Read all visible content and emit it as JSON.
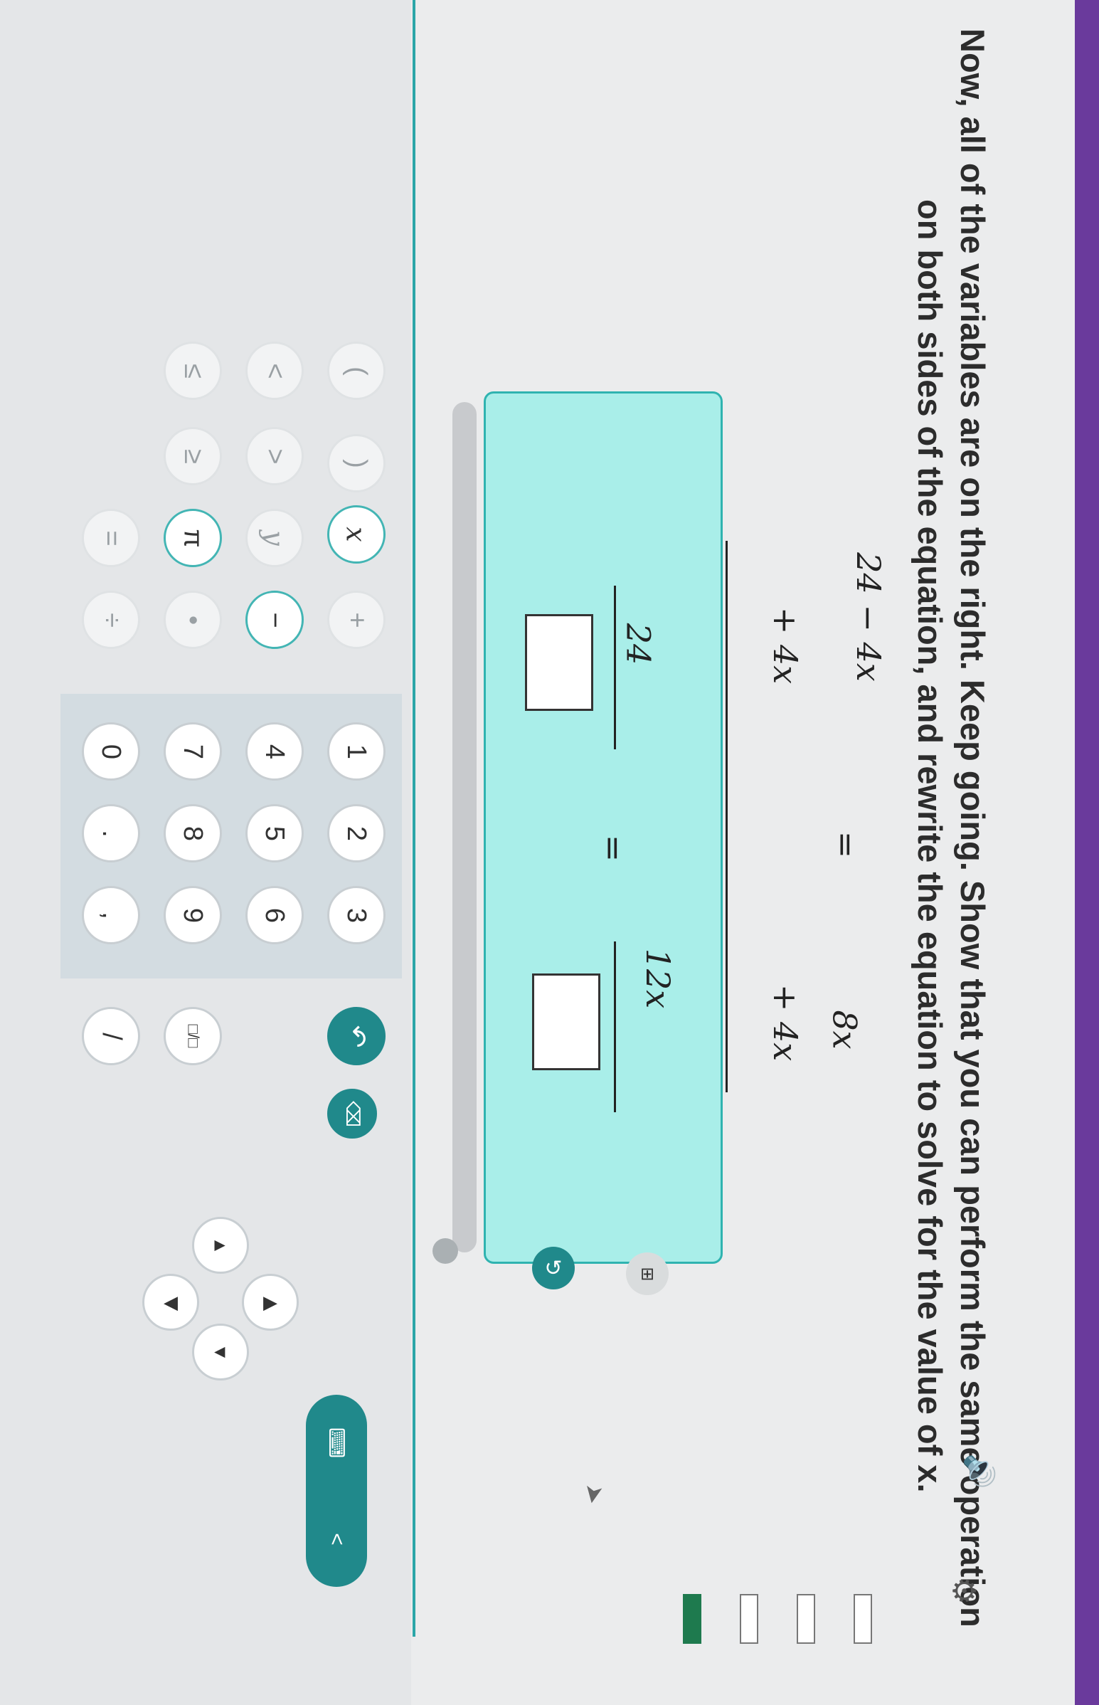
{
  "prompt": {
    "line1": "Now, all of the variables are on the right. Keep going. Show that you can perform the same operation",
    "line2": "on both sides of the equation, and rewrite the equation to solve for the value of x."
  },
  "equation": {
    "left_top": "24 − 4x",
    "equals_top": "=",
    "right_top": "8x",
    "left_add": "+ 4x",
    "right_add": "+ 4x",
    "left_result": "24",
    "equals_result": "=",
    "right_result": "12x"
  },
  "keypad": {
    "row_vars": [
      "x",
      "y",
      "π"
    ],
    "row_parens": [
      "(",
      ")"
    ],
    "row_compare": [
      "<",
      ">",
      "≤",
      "≥",
      "="
    ],
    "row_ops": [
      "+",
      "−",
      "•",
      "÷"
    ],
    "digits": [
      "1",
      "2",
      "3",
      "4",
      "5",
      "6",
      "7",
      "8",
      "9",
      "0",
      ".",
      ","
    ],
    "extra": [
      "/",
      "□/□"
    ],
    "undo": "↶",
    "backspace": "⌫",
    "toggle_chevron": "<"
  },
  "colors": {
    "teal": "#20898b",
    "workbox": "#a9eee9",
    "progress": "#1e7a4e"
  }
}
